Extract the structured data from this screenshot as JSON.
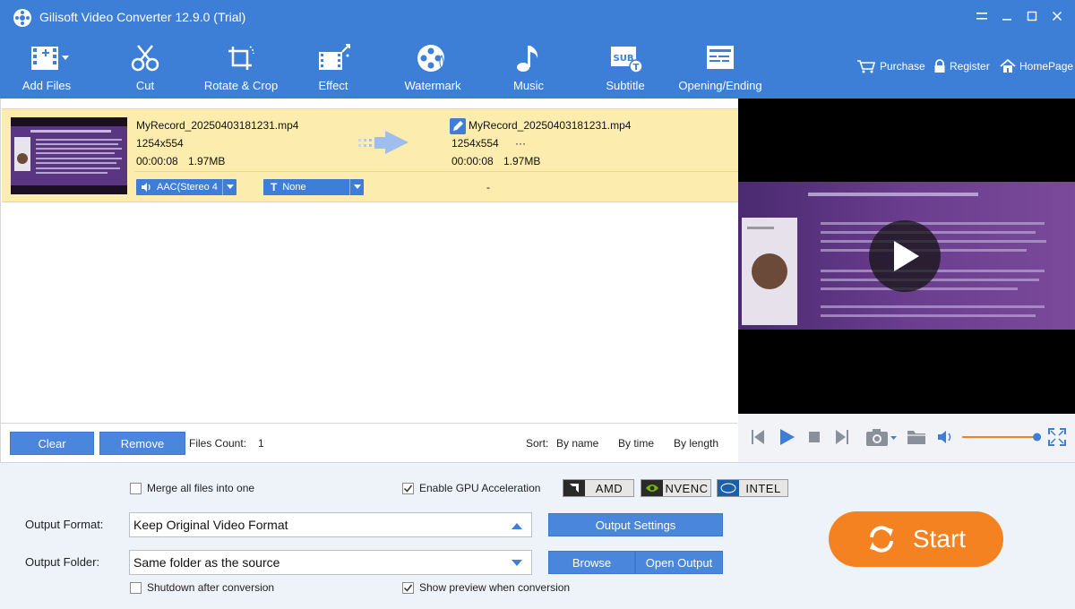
{
  "window": {
    "title": "Gilisoft Video Converter 12.9.0 (Trial)"
  },
  "toolbar": {
    "items": [
      {
        "label": "Add Files",
        "icon": "add-files-icon"
      },
      {
        "label": "Cut",
        "icon": "scissors-icon"
      },
      {
        "label": "Rotate & Crop",
        "icon": "crop-icon"
      },
      {
        "label": "Effect",
        "icon": "effect-icon"
      },
      {
        "label": "Watermark",
        "icon": "watermark-icon"
      },
      {
        "label": "Music",
        "icon": "music-note-icon"
      },
      {
        "label": "Subtitle",
        "icon": "subtitle-icon"
      },
      {
        "label": "Opening/Ending",
        "icon": "opening-ending-icon"
      }
    ],
    "links": {
      "purchase": "Purchase",
      "register": "Register",
      "homepage": "HomePage"
    }
  },
  "file": {
    "source_name": "MyRecord_20250403181231.mp4",
    "source_resolution": "1254x554",
    "source_duration": "00:00:08",
    "source_size": "1.97MB",
    "output_name": "MyRecord_20250403181231.mp4",
    "output_resolution": "1254x554",
    "output_extra": "···",
    "output_duration": "00:00:08",
    "output_size": "1.97MB",
    "audio_track": "AAC(Stereo 4",
    "subtitle_track": "None",
    "subtitle_output": "-"
  },
  "list_footer": {
    "clear": "Clear",
    "remove": "Remove",
    "files_count_label": "Files Count:",
    "files_count": "1",
    "sort_label": "Sort:",
    "sort_by_name": "By name",
    "sort_by_time": "By time",
    "sort_by_length": "By length"
  },
  "player": {
    "volume": 0.95
  },
  "options": {
    "merge_label": "Merge all files into one",
    "merge_checked": false,
    "gpu_label": "Enable GPU Acceleration",
    "gpu_checked": true,
    "amd": "AMD",
    "nvenc": "NVENC",
    "intel": "INTEL",
    "output_format_label": "Output Format:",
    "output_format_value": "Keep Original Video Format",
    "output_settings": "Output Settings",
    "output_folder_label": "Output Folder:",
    "output_folder_value": "Same folder as the source",
    "browse": "Browse",
    "open_output": "Open Output",
    "shutdown_label": "Shutdown after conversion",
    "shutdown_checked": false,
    "preview_label": "Show preview when conversion",
    "preview_checked": true,
    "start": "Start"
  },
  "colors": {
    "header_blue": "#3d7fd6",
    "selected_row": "#fcecae",
    "button_blue": "#4a86dc",
    "start_orange": "#f58220"
  }
}
